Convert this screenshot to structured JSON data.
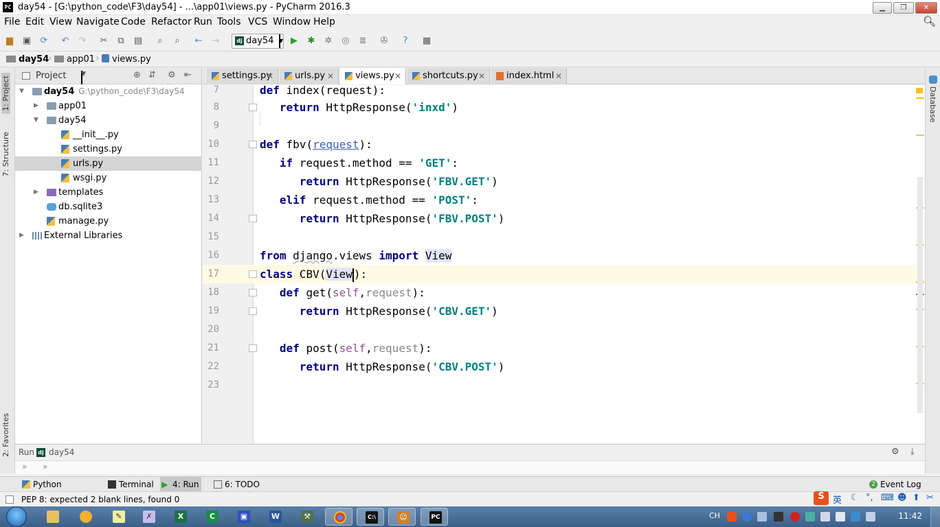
{
  "window": {
    "title": "day54 - [G:\\python_code\\F3\\day54] - ...\\app01\\views.py - PyCharm 2016.3",
    "app_icon": "PC"
  },
  "menu": [
    "File",
    "Edit",
    "View",
    "Navigate",
    "Code",
    "Refactor",
    "Run",
    "Tools",
    "VCS",
    "Window",
    "Help"
  ],
  "toolbar": {
    "run_config": "day54"
  },
  "breadcrumb": [
    "day54",
    "app01",
    "views.py"
  ],
  "left_tool_tabs": [
    "1: Project",
    "7: Structure",
    "2: Favorites"
  ],
  "right_tool_tabs": [
    "Database"
  ],
  "project": {
    "label": "Project",
    "tree": [
      {
        "name": "day54",
        "path": "G:\\python_code\\F3\\day54",
        "type": "folder",
        "depth": 0,
        "expanded": true,
        "bold": true
      },
      {
        "name": "app01",
        "type": "folder",
        "depth": 1,
        "expanded": false
      },
      {
        "name": "day54",
        "type": "folder",
        "depth": 1,
        "expanded": true
      },
      {
        "name": "__init__.py",
        "type": "py",
        "depth": 2
      },
      {
        "name": "settings.py",
        "type": "py",
        "depth": 2
      },
      {
        "name": "urls.py",
        "type": "py",
        "depth": 2,
        "selected": true
      },
      {
        "name": "wsgi.py",
        "type": "py",
        "depth": 2
      },
      {
        "name": "templates",
        "type": "folder-purple",
        "depth": 1,
        "expanded": false
      },
      {
        "name": "db.sqlite3",
        "type": "db",
        "depth": 1
      },
      {
        "name": "manage.py",
        "type": "py",
        "depth": 1
      },
      {
        "name": "External Libraries",
        "type": "lib",
        "depth": 0,
        "expanded": false
      }
    ]
  },
  "tabs": [
    {
      "label": "settings.py",
      "active": false
    },
    {
      "label": "urls.py",
      "active": false
    },
    {
      "label": "views.py",
      "active": true
    },
    {
      "label": "shortcuts.py",
      "active": false
    },
    {
      "label": "index.html",
      "active": false
    }
  ],
  "editor": {
    "lines": [
      {
        "n": "7",
        "text": "def index(request):"
      },
      {
        "n": "8",
        "text": "    return HttpResponse('inxd')"
      },
      {
        "n": "9",
        "text": ""
      },
      {
        "n": "10",
        "text": "def fbv(request):"
      },
      {
        "n": "11",
        "text": "    if request.method == 'GET':"
      },
      {
        "n": "12",
        "text": "        return HttpResponse('FBV.GET')"
      },
      {
        "n": "13",
        "text": "    elif request.method == 'POST':"
      },
      {
        "n": "14",
        "text": "        return HttpResponse('FBV.POST')"
      },
      {
        "n": "15",
        "text": ""
      },
      {
        "n": "16",
        "text": "from django.views import View"
      },
      {
        "n": "17",
        "text": "class CBV(View):"
      },
      {
        "n": "18",
        "text": "    def get(self,request):"
      },
      {
        "n": "19",
        "text": "        return HttpResponse('CBV.GET')"
      },
      {
        "n": "20",
        "text": ""
      },
      {
        "n": "21",
        "text": "    def post(self,request):"
      },
      {
        "n": "22",
        "text": "        return HttpResponse('CBV.POST')"
      },
      {
        "n": "23",
        "text": ""
      }
    ],
    "current_line": "17"
  },
  "run_panel": {
    "label": "Run",
    "config": "day54",
    "sub": "»"
  },
  "bottom_tabs": [
    {
      "label": "Python Console",
      "active": false
    },
    {
      "label": "Terminal",
      "active": false
    },
    {
      "label": "4: Run",
      "active": true
    },
    {
      "label": "6: TODO",
      "active": false
    }
  ],
  "event_log": {
    "count": "2",
    "label": "Event Log"
  },
  "status": {
    "message": "PEP 8: expected 2 blank lines, found 0"
  },
  "ime": {
    "lang": "英"
  },
  "taskbar": {
    "lang": "CH",
    "time": "11:42",
    "apps": [
      "explorer",
      "paint",
      "notepad",
      "tool",
      "excel",
      "c-app",
      "save",
      "word",
      "tool2",
      "chrome",
      "cmd",
      "media",
      "pycharm"
    ]
  },
  "colors": {
    "keyword": "#000080",
    "string": "#008080",
    "self": "#94558d",
    "current_line": "#fffae3",
    "taskbar": "#3a5f88"
  }
}
